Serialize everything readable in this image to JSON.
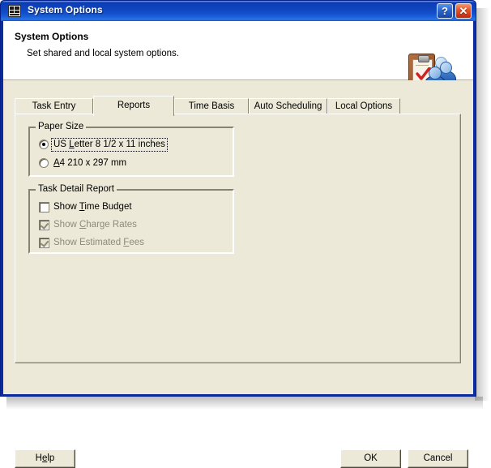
{
  "window": {
    "title": "System Options",
    "icon": "options-grid-icon",
    "controls": [
      {
        "name": "help-titlebar-button",
        "glyph": "?"
      },
      {
        "name": "close-button",
        "glyph": "✕"
      }
    ]
  },
  "header": {
    "title": "System Options",
    "subtitle": "Set shared and local system options.",
    "icon": "clipboard-users-icon"
  },
  "tabs": [
    {
      "label": "Task Entry",
      "active": false
    },
    {
      "label": "Reports",
      "active": true
    },
    {
      "label": "Time Basis",
      "active": false
    },
    {
      "label": "Auto Scheduling",
      "active": false
    },
    {
      "label": "Local Options",
      "active": false
    }
  ],
  "paper_size": {
    "legend": "Paper Size",
    "options": [
      {
        "pre": "US ",
        "accel": "L",
        "post": "etter 8 1/2 x 11 inches",
        "selected": true,
        "focused": true
      },
      {
        "pre": "",
        "accel": "A",
        "post": "4 210 x 297 mm",
        "selected": false,
        "focused": false
      }
    ]
  },
  "task_detail_report": {
    "legend": "Task Detail Report",
    "options": [
      {
        "pre": "Show ",
        "accel": "T",
        "post": "ime Budget",
        "checked": false,
        "disabled": false
      },
      {
        "pre": "Show ",
        "accel": "C",
        "post": "harge Rates",
        "checked": true,
        "disabled": true
      },
      {
        "pre": "Show Estimated ",
        "accel": "F",
        "post": "ees",
        "checked": true,
        "disabled": true
      }
    ]
  },
  "footer": {
    "help": {
      "pre": "H",
      "accel": "e",
      "post": "lp"
    },
    "ok_label": "OK",
    "cancel_label": "Cancel"
  },
  "colors": {
    "titlebar_blue": "#0c3cb4",
    "window_border": "#0a2ca0",
    "dialog_face": "#ece9d8",
    "close_red": "#e2572b",
    "disabled_text": "#8d8a78"
  }
}
